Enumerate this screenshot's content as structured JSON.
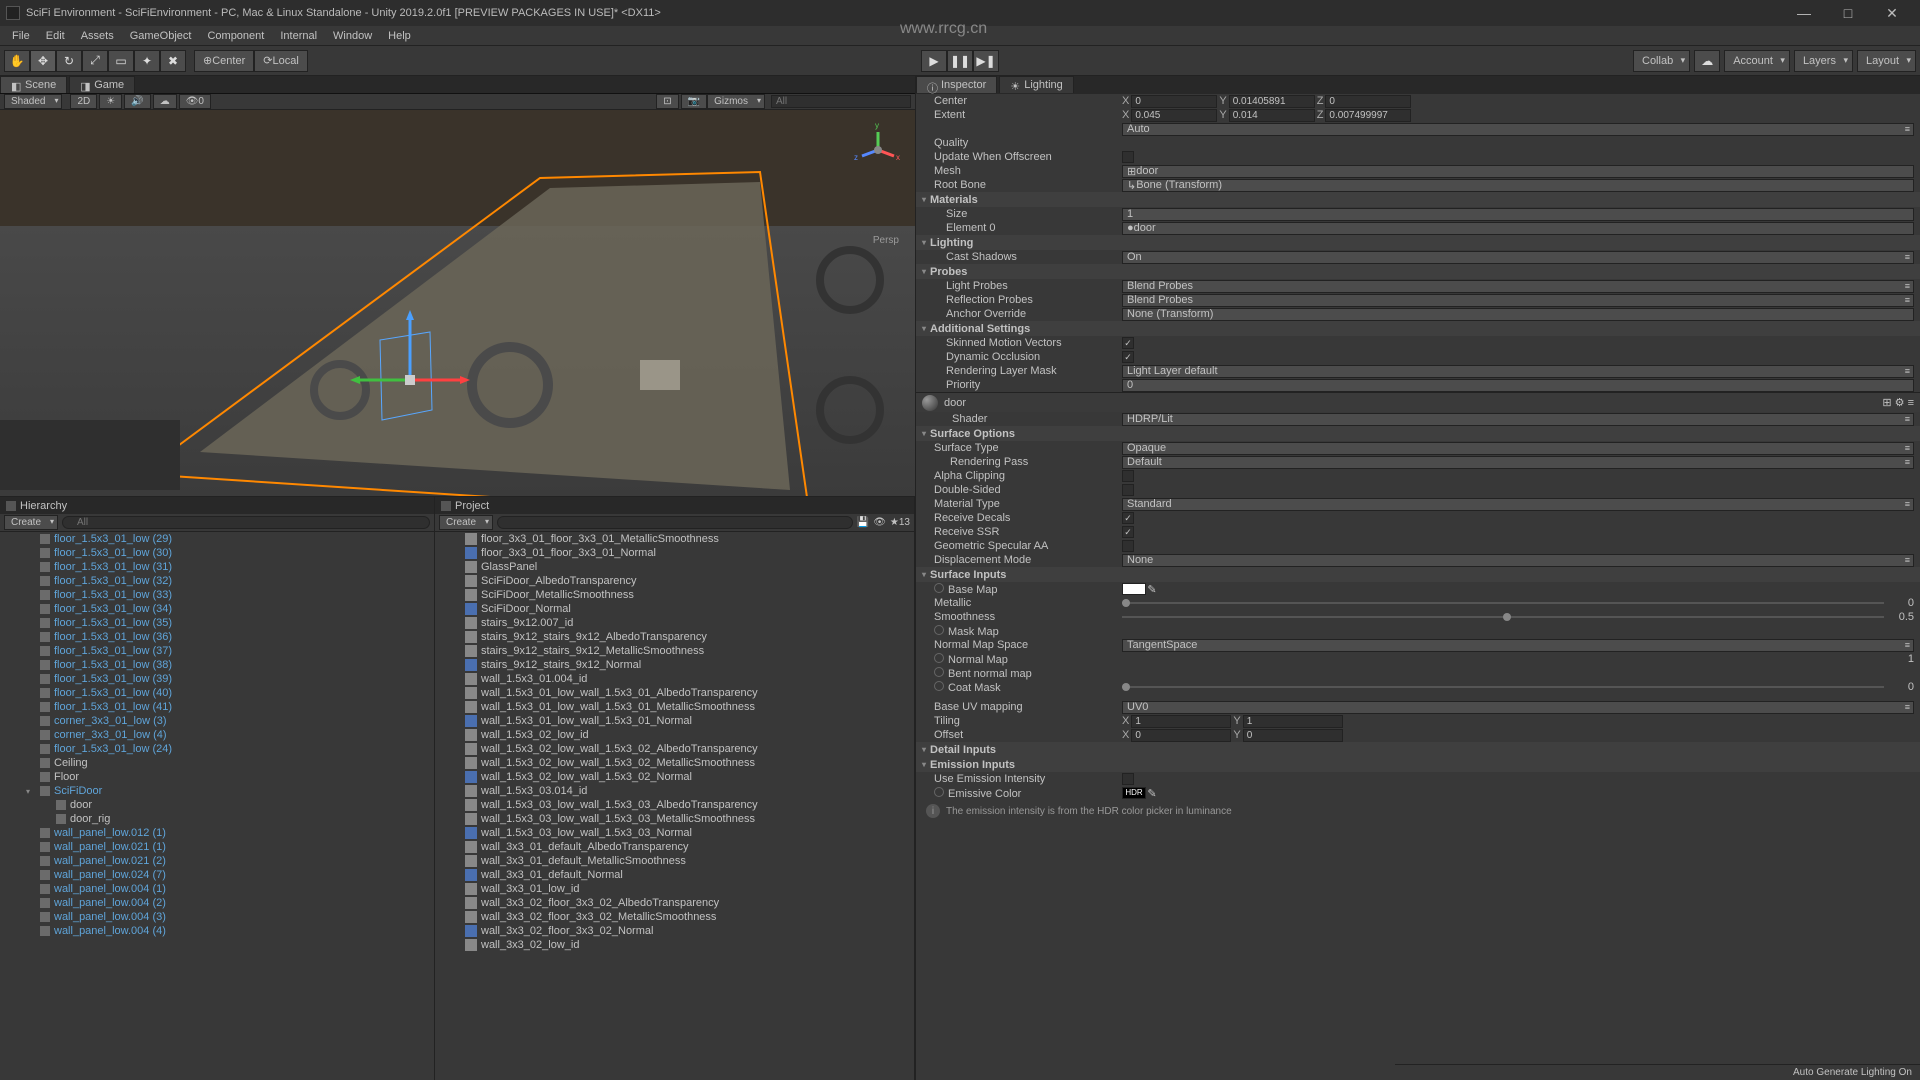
{
  "title": "SciFi Environment - SciFiEnvironment - PC, Mac & Linux Standalone - Unity 2019.2.0f1 [PREVIEW PACKAGES IN USE]* <DX11>",
  "watermark": "www.rrcg.cn",
  "menu": [
    "File",
    "Edit",
    "Assets",
    "GameObject",
    "Component",
    "Internal",
    "Window",
    "Help"
  ],
  "toolbar": {
    "pivot": "Center",
    "space": "Local",
    "collab": "Collab",
    "account": "Account",
    "layers": "Layers",
    "layout": "Layout"
  },
  "scene": {
    "tab_scene": "Scene",
    "tab_game": "Game",
    "shading": "Shaded",
    "twod": "2D",
    "gizmos": "Gizmos",
    "search_ph": "All",
    "persp": "Persp"
  },
  "hierarchy": {
    "title": "Hierarchy",
    "create": "Create",
    "search_ph": "All",
    "items": [
      "floor_1.5x3_01_low (29)",
      "floor_1.5x3_01_low (30)",
      "floor_1.5x3_01_low (31)",
      "floor_1.5x3_01_low (32)",
      "floor_1.5x3_01_low (33)",
      "floor_1.5x3_01_low (34)",
      "floor_1.5x3_01_low (35)",
      "floor_1.5x3_01_low (36)",
      "floor_1.5x3_01_low (37)",
      "floor_1.5x3_01_low (38)",
      "floor_1.5x3_01_low (39)",
      "floor_1.5x3_01_low (40)",
      "floor_1.5x3_01_low (41)",
      "corner_3x3_01_low (3)",
      "corner_3x3_01_low (4)",
      "floor_1.5x3_01_low (24)",
      "Ceiling",
      "Floor",
      "SciFiDoor",
      "door",
      "door_rig",
      "wall_panel_low.012 (1)",
      "wall_panel_low.021 (1)",
      "wall_panel_low.021 (2)",
      "wall_panel_low.024 (7)",
      "wall_panel_low.004 (1)",
      "wall_panel_low.004 (2)",
      "wall_panel_low.004 (3)",
      "wall_panel_low.004 (4)"
    ]
  },
  "project": {
    "title": "Project",
    "create": "Create",
    "count": "13",
    "items": [
      "floor_3x3_01_floor_3x3_01_MetallicSmoothness",
      "floor_3x3_01_floor_3x3_01_Normal",
      "GlassPanel",
      "SciFiDoor_AlbedoTransparency",
      "SciFiDoor_MetallicSmoothness",
      "SciFiDoor_Normal",
      "stairs_9x12.007_id",
      "stairs_9x12_stairs_9x12_AlbedoTransparency",
      "stairs_9x12_stairs_9x12_MetallicSmoothness",
      "stairs_9x12_stairs_9x12_Normal",
      "wall_1.5x3_01.004_id",
      "wall_1.5x3_01_low_wall_1.5x3_01_AlbedoTransparency",
      "wall_1.5x3_01_low_wall_1.5x3_01_MetallicSmoothness",
      "wall_1.5x3_01_low_wall_1.5x3_01_Normal",
      "wall_1.5x3_02_low_id",
      "wall_1.5x3_02_low_wall_1.5x3_02_AlbedoTransparency",
      "wall_1.5x3_02_low_wall_1.5x3_02_MetallicSmoothness",
      "wall_1.5x3_02_low_wall_1.5x3_02_Normal",
      "wall_1.5x3_03.014_id",
      "wall_1.5x3_03_low_wall_1.5x3_03_AlbedoTransparency",
      "wall_1.5x3_03_low_wall_1.5x3_03_MetallicSmoothness",
      "wall_1.5x3_03_low_wall_1.5x3_03_Normal",
      "wall_3x3_01_default_AlbedoTransparency",
      "wall_3x3_01_default_MetallicSmoothness",
      "wall_3x3_01_default_Normal",
      "wall_3x3_01_low_id",
      "wall_3x3_02_floor_3x3_02_AlbedoTransparency",
      "wall_3x3_02_floor_3x3_02_MetallicSmoothness",
      "wall_3x3_02_floor_3x3_02_Normal",
      "wall_3x3_02_low_id"
    ]
  },
  "inspector": {
    "tab_inspector": "Inspector",
    "tab_lighting": "Lighting",
    "center": "Center",
    "cx": "0",
    "cy": "0.01405891",
    "cz": "0",
    "extent": "Extent",
    "ex": "0.045",
    "ey": "0.014",
    "ez": "0.007499997",
    "auto": "Auto",
    "quality": "Quality",
    "update_offscreen": "Update When Offscreen",
    "mesh": "Mesh",
    "mesh_val": "door",
    "root_bone": "Root Bone",
    "root_bone_val": "Bone (Transform)",
    "materials": "Materials",
    "size": "Size",
    "size_val": "1",
    "element0": "Element 0",
    "element0_val": "door",
    "lighting": "Lighting",
    "cast_shadows": "Cast Shadows",
    "cast_shadows_val": "On",
    "probes": "Probes",
    "light_probes": "Light Probes",
    "light_probes_val": "Blend Probes",
    "reflection_probes": "Reflection Probes",
    "reflection_probes_val": "Blend Probes",
    "anchor_override": "Anchor Override",
    "anchor_override_val": "None (Transform)",
    "additional": "Additional Settings",
    "skinned_motion": "Skinned Motion Vectors",
    "dynamic_occlusion": "Dynamic Occlusion",
    "rendering_layer": "Rendering Layer Mask",
    "rendering_layer_val": "Light Layer default",
    "priority": "Priority",
    "priority_val": "0",
    "mat_name": "door",
    "shader": "Shader",
    "shader_val": "HDRP/Lit",
    "surface_options": "Surface Options",
    "surface_type": "Surface Type",
    "surface_type_val": "Opaque",
    "rendering_pass": "Rendering Pass",
    "rendering_pass_val": "Default",
    "alpha_clipping": "Alpha Clipping",
    "double_sided": "Double-Sided",
    "material_type": "Material Type",
    "material_type_val": "Standard",
    "receive_decals": "Receive Decals",
    "receive_ssr": "Receive SSR",
    "geometric_aa": "Geometric Specular AA",
    "displacement": "Displacement Mode",
    "displacement_val": "None",
    "surface_inputs": "Surface Inputs",
    "base_map": "Base Map",
    "metallic": "Metallic",
    "metallic_val": "0",
    "smoothness": "Smoothness",
    "smoothness_val": "0.5",
    "mask_map": "Mask Map",
    "normal_map_space": "Normal Map Space",
    "normal_map_space_val": "TangentSpace",
    "normal_map": "Normal Map",
    "normal_map_val": "1",
    "bent_normal": "Bent normal map",
    "coat_mask": "Coat Mask",
    "coat_mask_val": "0",
    "base_uv": "Base UV mapping",
    "base_uv_val": "UV0",
    "tiling": "Tiling",
    "tiling_x": "1",
    "tiling_y": "1",
    "offset": "Offset",
    "offset_x": "0",
    "offset_y": "0",
    "detail_inputs": "Detail Inputs",
    "emission_inputs": "Emission Inputs",
    "use_emission": "Use Emission Intensity",
    "emissive_color": "Emissive Color",
    "emissive_hdr": "HDR",
    "emission_hint": "The emission intensity is from the HDR color picker in luminance",
    "auto_gen": "Auto Generate Lighting On",
    "x": "X",
    "y": "Y",
    "z": "Z"
  }
}
